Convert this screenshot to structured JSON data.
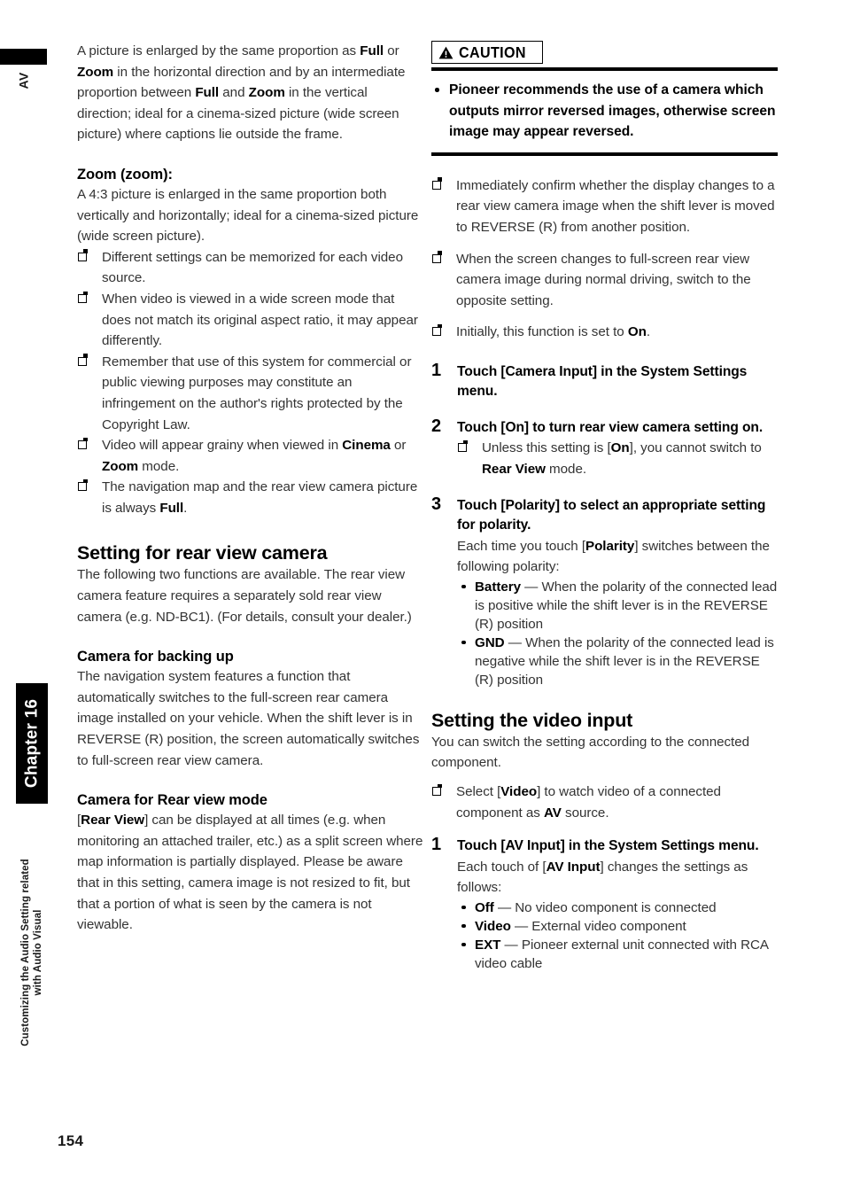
{
  "edge_marker": {
    "tab_label": "AV"
  },
  "chapter_rail": {
    "chapter_label": "Chapter 16",
    "subtitle_line1": "Customizing the Audio Setting related",
    "subtitle_line2": "with Audio Visual"
  },
  "page_number": "154",
  "left_column": {
    "intro_paragraph_html": "A picture is enlarged by the same proportion as <b>Full</b> or <b>Zoom</b> in the horizontal direction and by an intermediate proportion between <b>Full</b> and <b>Zoom</b> in the vertical direction; ideal for a cinema-sized picture (wide screen picture) where captions lie outside the frame.",
    "zoom_heading": "Zoom (zoom):",
    "zoom_paragraph": "A 4:3 picture is enlarged in the same proportion both vertically and horizontally; ideal for a cinema-sized picture (wide screen picture).",
    "zoom_notes": [
      "Different settings can be memorized for each video source.",
      "When video is viewed in a wide screen mode that does not match its original aspect ratio, it may appear differently.",
      "Remember that use of this system for commercial or public viewing purposes may constitute an infringement on the author's rights protected by the Copyright Law.",
      "Video will appear grainy when viewed in <b>Cinema</b> or <b>Zoom</b> mode.",
      "The navigation map and the rear view camera picture is always <b>Full</b>."
    ],
    "rear_view_section_title": "Setting for rear view camera",
    "rear_view_paragraph": "The following two functions are available. The rear view camera feature requires a separately sold rear view camera (e.g. ND-BC1). (For details, consult your dealer.)",
    "backing_up_title": "Camera for backing up",
    "backing_up_paragraph": "The navigation system features a function that automatically switches to the full-screen rear camera image installed on your vehicle. When the shift lever is in REVERSE (R) position, the screen automatically switches to full-screen rear view camera.",
    "rear_view_mode_title": "Camera for Rear view mode",
    "rear_view_mode_paragraph_html": "[<b>Rear View</b>] can be displayed at all times (e.g. when monitoring an attached trailer, etc.) as a split screen where map information is partially displayed. Please be aware that in this setting, camera image is not resized to fit, but that a portion of what is seen by the camera is not viewable."
  },
  "right_column": {
    "caution": {
      "icon": "warning-triangle-icon",
      "label": "CAUTION",
      "bullet": "Pioneer recommends the use of a camera which outputs mirror reversed images, otherwise screen image may appear reversed."
    },
    "camera_notes": [
      "Immediately confirm whether the display changes to a rear view camera image when the shift lever is moved to REVERSE (R) from another position.",
      "When the screen changes to full-screen rear view camera image during normal driving, switch to the opposite setting.",
      "Initially, this function is set to <b>On</b>."
    ],
    "steps": [
      {
        "number": "1",
        "title": "Touch [Camera Input] in the System Settings menu."
      },
      {
        "number": "2",
        "title": "Touch [On] to turn rear view camera setting on.",
        "notes": [
          "Unless this setting is [<b>On</b>], you cannot switch to <b>Rear View</b> mode."
        ]
      },
      {
        "number": "3",
        "title": "Touch [Polarity] to select an appropriate setting for polarity.",
        "body_html": "Each time you touch [<b>Polarity</b>] switches between the following polarity:",
        "options": [
          "<b>Battery</b> &mdash; When the polarity of the connected lead is positive while the shift lever is in the REVERSE (R) position",
          "<b>GND</b> &mdash; When the polarity of the connected lead is negative while the shift lever is in the REVERSE (R) position"
        ]
      }
    ],
    "video_input_section_title": "Setting the video input",
    "video_input_paragraph": "You can switch the setting according to the connected component.",
    "video_input_notes": [
      "Select [<b>Video</b>] to watch video of a connected component as <b>AV</b> source."
    ],
    "video_steps": [
      {
        "number": "1",
        "title": "Touch [AV Input] in the System Settings menu.",
        "body_html": "Each touch of [<b>AV Input</b>] changes the settings as follows:",
        "options": [
          "<b>Off</b> &mdash; No video component is connected",
          "<b>Video</b> &mdash; External video component",
          "<b>EXT</b> &mdash; Pioneer external unit connected with RCA video cable"
        ]
      }
    ]
  }
}
